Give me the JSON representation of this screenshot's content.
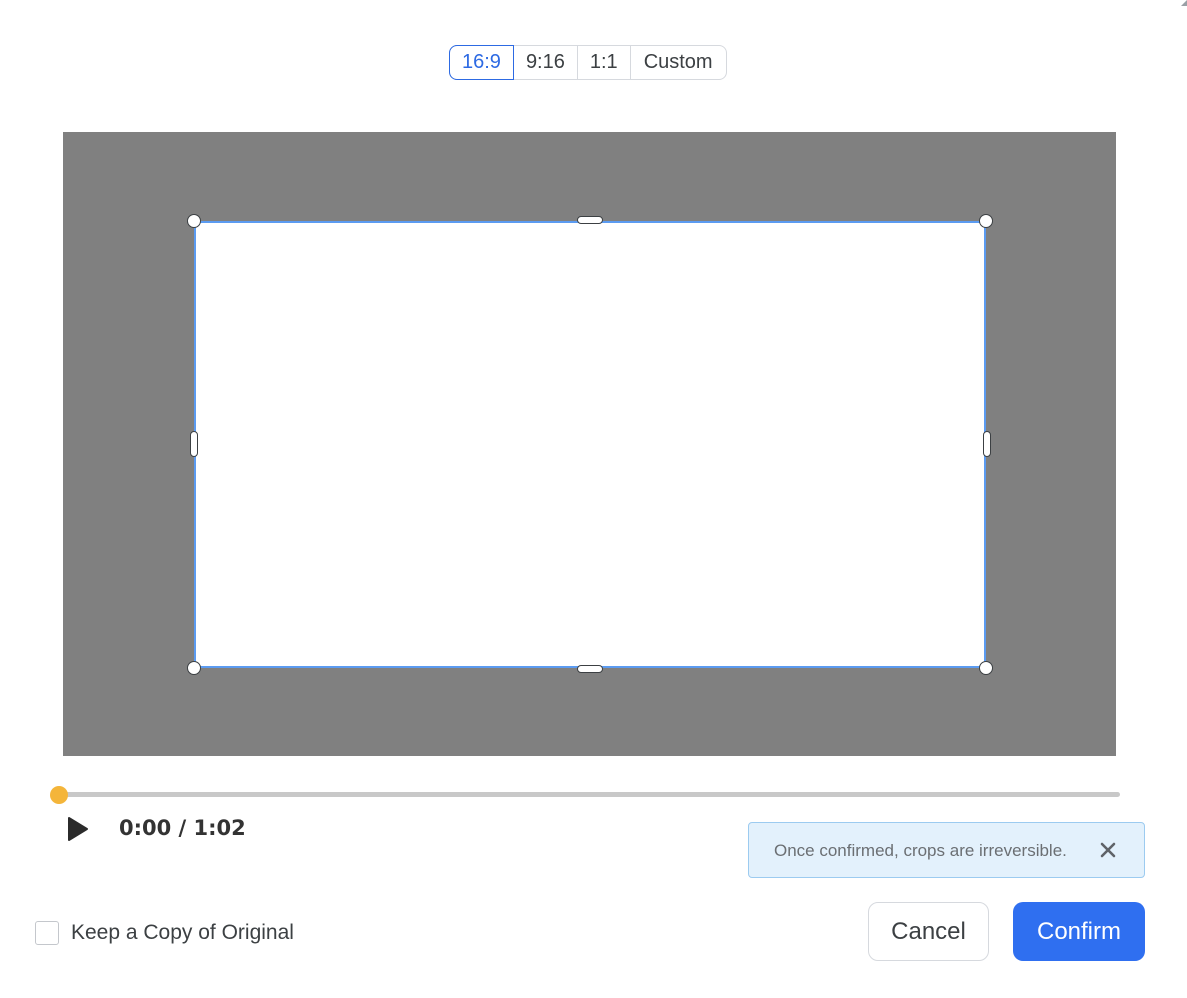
{
  "aspect_ratios": {
    "options": [
      "16:9",
      "9:16",
      "1:1",
      "Custom"
    ],
    "selected": "16:9"
  },
  "player": {
    "time_display": "0:00 / 1:02",
    "progress": 0
  },
  "notice": {
    "text": "Once confirmed, crops are irreversible."
  },
  "footer": {
    "keep_copy_label": "Keep a Copy of Original",
    "keep_copy_checked": false,
    "cancel_label": "Cancel",
    "confirm_label": "Confirm"
  },
  "colors": {
    "accent": "#2f6ff0",
    "playhead": "#f4b53a",
    "stage": "#808080",
    "crop_border": "#5b9bf1",
    "notice_bg": "#e3f1fc"
  }
}
